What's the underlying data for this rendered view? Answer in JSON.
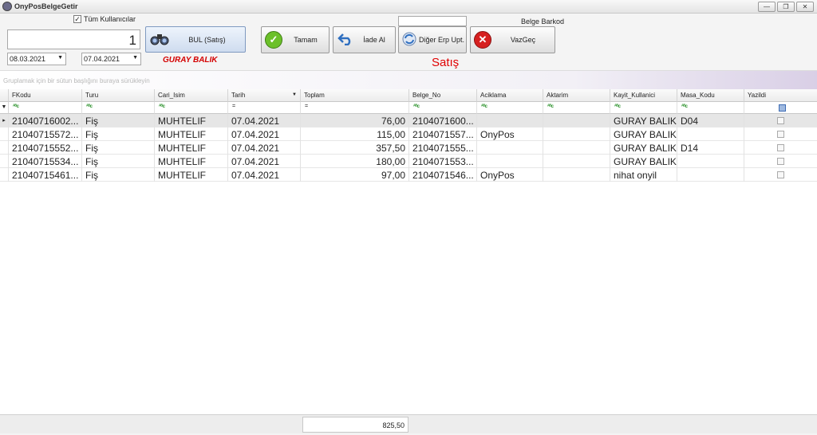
{
  "window": {
    "title": "OnyPosBelgeGetir",
    "min": "—",
    "restore": "❐",
    "close": "✕"
  },
  "toolbar": {
    "all_users_label": "Tüm Kullanıcılar",
    "all_users_checked": "✓",
    "number_value": "1",
    "date_from": "08.03.2021",
    "date_to": "07.04.2021",
    "find_label": "BUL (Satış)",
    "ok_label": "Tamam",
    "return_label": "İade Al",
    "other_erp_label": "Diğer Erp Upt.",
    "cancel_label": "VazGeç",
    "barcode_label": "Belge Barkod",
    "barcode_value": "",
    "user_name": "GURAY BALIK",
    "mode_label": "Satış"
  },
  "grid": {
    "group_hint": "Gruplamak için bir sütun başlığını buraya sürükleyin",
    "columns": [
      "FKodu",
      "Turu",
      "Cari_Isim",
      "Tarih",
      "Toplam",
      "Belge_No",
      "Aciklama",
      "Aktarim",
      "Kayit_Kullanici",
      "Masa_Kodu",
      "Yazildi"
    ],
    "filter_eq": "=",
    "filter_abc": "ᴬᴮc",
    "rows": [
      {
        "fkodu": "21040716002...",
        "turu": "Fiş",
        "cari": "MUHTELIF",
        "tarih": "07.04.2021",
        "toplam": "76,00",
        "belge": "2104071600...",
        "aciklama": "",
        "aktarim": "",
        "kullanici": "GURAY BALIK",
        "masa": "D04"
      },
      {
        "fkodu": "21040715572...",
        "turu": "Fiş",
        "cari": "MUHTELIF",
        "tarih": "07.04.2021",
        "toplam": "115,00",
        "belge": "2104071557...",
        "aciklama": "OnyPos",
        "aktarim": "",
        "kullanici": "GURAY BALIK",
        "masa": ""
      },
      {
        "fkodu": "21040715552...",
        "turu": "Fiş",
        "cari": "MUHTELIF",
        "tarih": "07.04.2021",
        "toplam": "357,50",
        "belge": "2104071555...",
        "aciklama": "",
        "aktarim": "",
        "kullanici": "GURAY BALIK",
        "masa": "D14"
      },
      {
        "fkodu": "21040715534...",
        "turu": "Fiş",
        "cari": "MUHTELIF",
        "tarih": "07.04.2021",
        "toplam": "180,00",
        "belge": "2104071553...",
        "aciklama": "",
        "aktarim": "",
        "kullanici": "GURAY BALIK",
        "masa": ""
      },
      {
        "fkodu": "21040715461...",
        "turu": "Fiş",
        "cari": "MUHTELIF",
        "tarih": "07.04.2021",
        "toplam": "97,00",
        "belge": "2104071546...",
        "aciklama": "OnyPos",
        "aktarim": "",
        "kullanici": "nihat onyil",
        "masa": ""
      }
    ],
    "total": "825,50"
  },
  "colors": {
    "accent_red": "#d40000",
    "ok_green": "#6cc02a",
    "return_blue": "#2f6fc0",
    "cancel_red": "#d62020"
  }
}
